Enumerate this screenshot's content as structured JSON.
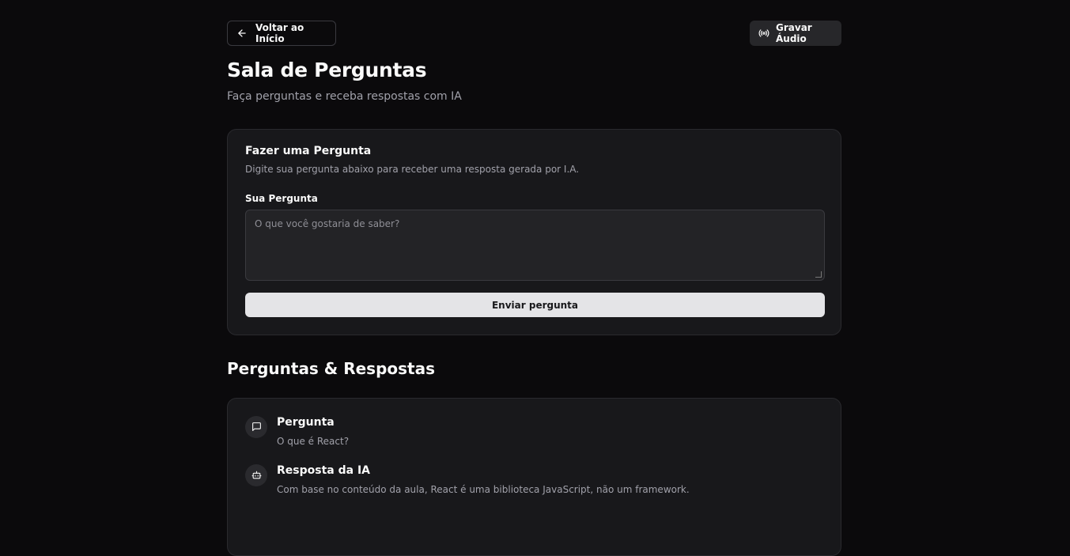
{
  "header": {
    "back_label": "Voltar ao Início",
    "record_label": "Gravar Áudio",
    "title": "Sala de Perguntas",
    "subtitle": "Faça perguntas e receba respostas com IA"
  },
  "ask_form": {
    "title": "Fazer uma Pergunta",
    "description": "Digite sua pergunta abaixo para receber uma resposta gerada por I.A.",
    "field_label": "Sua Pergunta",
    "placeholder": "O que você gostaria de saber?",
    "value": "",
    "submit_label": "Enviar pergunta"
  },
  "qa_section": {
    "title": "Perguntas & Respostas",
    "items": [
      {
        "question_heading": "Pergunta",
        "question": "O que é React?",
        "answer_heading": "Resposta da IA",
        "answer": "Com base no conteúdo da aula, React é uma biblioteca JavaScript, não um framework."
      }
    ]
  },
  "icons": {
    "back": "arrow-left-icon",
    "record": "radio-icon",
    "question": "message-square-icon",
    "answer": "bot-icon"
  },
  "colors": {
    "background": "#0b0a0c",
    "card": "#18181b",
    "primary_button": "#e4e4e7",
    "muted_text": "#a1a1aa"
  }
}
